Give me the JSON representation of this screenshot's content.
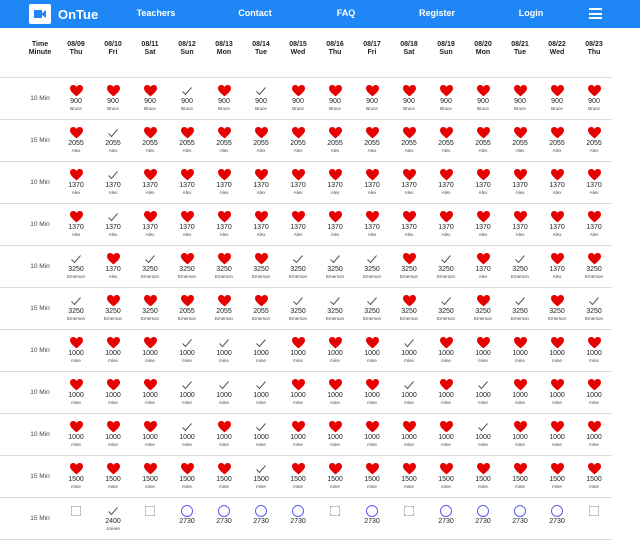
{
  "nav": {
    "brand": "OnTue",
    "links": [
      "Teachers",
      "Contact",
      "FAQ",
      "Register",
      "Login"
    ],
    "brand_color": "#1f86f5"
  },
  "header": {
    "time_label_1": "Time",
    "time_label_2": "Minute",
    "days": [
      {
        "date": "08/09",
        "dow": "Thu"
      },
      {
        "date": "08/10",
        "dow": "Fri"
      },
      {
        "date": "08/11",
        "dow": "Sat"
      },
      {
        "date": "08/12",
        "dow": "Sun"
      },
      {
        "date": "08/13",
        "dow": "Mon"
      },
      {
        "date": "08/14",
        "dow": "Tue"
      },
      {
        "date": "08/15",
        "dow": "Wed"
      },
      {
        "date": "08/16",
        "dow": "Thu"
      },
      {
        "date": "08/17",
        "dow": "Fri"
      },
      {
        "date": "08/18",
        "dow": "Sat"
      },
      {
        "date": "08/19",
        "dow": "Sun"
      },
      {
        "date": "08/20",
        "dow": "Mon"
      },
      {
        "date": "08/21",
        "dow": "Tue"
      },
      {
        "date": "08/22",
        "dow": "Wed"
      },
      {
        "date": "08/23",
        "dow": "Thu"
      }
    ]
  },
  "rows": [
    {
      "duration": "10 Min",
      "cells": [
        {
          "icon": "heart",
          "value": "900",
          "who": "Bruce"
        },
        {
          "icon": "heart",
          "value": "900",
          "who": "Bruce"
        },
        {
          "icon": "heart",
          "value": "900",
          "who": "Bruce"
        },
        {
          "icon": "check",
          "value": "900",
          "who": "Bruce"
        },
        {
          "icon": "heart",
          "value": "900",
          "who": "Bruce"
        },
        {
          "icon": "check",
          "value": "900",
          "who": "Bruce"
        },
        {
          "icon": "heart",
          "value": "900",
          "who": "Bruce"
        },
        {
          "icon": "heart",
          "value": "900",
          "who": "Bruce"
        },
        {
          "icon": "heart",
          "value": "900",
          "who": "Bruce"
        },
        {
          "icon": "heart",
          "value": "900",
          "who": "Bruce"
        },
        {
          "icon": "heart",
          "value": "900",
          "who": "Bruce"
        },
        {
          "icon": "heart",
          "value": "900",
          "who": "Bruce"
        },
        {
          "icon": "heart",
          "value": "900",
          "who": "Bruce"
        },
        {
          "icon": "heart",
          "value": "900",
          "who": "Bruce"
        },
        {
          "icon": "heart",
          "value": "900",
          "who": "Bruce"
        }
      ]
    },
    {
      "duration": "15 Min",
      "cells": [
        {
          "icon": "heart",
          "value": "2055",
          "who": "Alex"
        },
        {
          "icon": "check",
          "value": "2055",
          "who": "Alex"
        },
        {
          "icon": "heart",
          "value": "2055",
          "who": "Alex"
        },
        {
          "icon": "heart",
          "value": "2055",
          "who": "Alex"
        },
        {
          "icon": "heart",
          "value": "2055",
          "who": "Alex"
        },
        {
          "icon": "heart",
          "value": "2055",
          "who": "Alex"
        },
        {
          "icon": "heart",
          "value": "2055",
          "who": "Alex"
        },
        {
          "icon": "heart",
          "value": "2055",
          "who": "Alex"
        },
        {
          "icon": "heart",
          "value": "2055",
          "who": "Alex"
        },
        {
          "icon": "heart",
          "value": "2055",
          "who": "Alex"
        },
        {
          "icon": "heart",
          "value": "2055",
          "who": "Alex"
        },
        {
          "icon": "heart",
          "value": "2055",
          "who": "Alex"
        },
        {
          "icon": "heart",
          "value": "2055",
          "who": "Alex"
        },
        {
          "icon": "heart",
          "value": "2055",
          "who": "Alex"
        },
        {
          "icon": "heart",
          "value": "2055",
          "who": "Alex"
        }
      ]
    },
    {
      "duration": "10 Min",
      "cells": [
        {
          "icon": "heart",
          "value": "1370",
          "who": "Alex"
        },
        {
          "icon": "check",
          "value": "1370",
          "who": "Alex"
        },
        {
          "icon": "heart",
          "value": "1370",
          "who": "Alex"
        },
        {
          "icon": "heart",
          "value": "1370",
          "who": "Alex"
        },
        {
          "icon": "heart",
          "value": "1370",
          "who": "Alex"
        },
        {
          "icon": "heart",
          "value": "1370",
          "who": "Alex"
        },
        {
          "icon": "heart",
          "value": "1370",
          "who": "Alex"
        },
        {
          "icon": "heart",
          "value": "1370",
          "who": "Alex"
        },
        {
          "icon": "heart",
          "value": "1370",
          "who": "Alex"
        },
        {
          "icon": "heart",
          "value": "1370",
          "who": "Alex"
        },
        {
          "icon": "heart",
          "value": "1370",
          "who": "Alex"
        },
        {
          "icon": "heart",
          "value": "1370",
          "who": "Alex"
        },
        {
          "icon": "heart",
          "value": "1370",
          "who": "Alex"
        },
        {
          "icon": "heart",
          "value": "1370",
          "who": "Alex"
        },
        {
          "icon": "heart",
          "value": "1370",
          "who": "Alex"
        }
      ]
    },
    {
      "duration": "10 Min",
      "cells": [
        {
          "icon": "heart",
          "value": "1370",
          "who": "Alex"
        },
        {
          "icon": "check",
          "value": "1370",
          "who": "Alex"
        },
        {
          "icon": "heart",
          "value": "1370",
          "who": "Alex"
        },
        {
          "icon": "heart",
          "value": "1370",
          "who": "Alex"
        },
        {
          "icon": "heart",
          "value": "1370",
          "who": "Alex"
        },
        {
          "icon": "heart",
          "value": "1370",
          "who": "Alex"
        },
        {
          "icon": "heart",
          "value": "1370",
          "who": "Alex"
        },
        {
          "icon": "heart",
          "value": "1370",
          "who": "Alex"
        },
        {
          "icon": "heart",
          "value": "1370",
          "who": "Alex"
        },
        {
          "icon": "heart",
          "value": "1370",
          "who": "Alex"
        },
        {
          "icon": "heart",
          "value": "1370",
          "who": "Alex"
        },
        {
          "icon": "heart",
          "value": "1370",
          "who": "Alex"
        },
        {
          "icon": "heart",
          "value": "1370",
          "who": "Alex"
        },
        {
          "icon": "heart",
          "value": "1370",
          "who": "Alex"
        },
        {
          "icon": "heart",
          "value": "1370",
          "who": "Alex"
        }
      ]
    },
    {
      "duration": "10 Min",
      "cells": [
        {
          "icon": "check",
          "value": "3250",
          "who": "Emerson"
        },
        {
          "icon": "heart",
          "value": "1370",
          "who": "Alex"
        },
        {
          "icon": "check",
          "value": "3250",
          "who": "Emerson"
        },
        {
          "icon": "heart",
          "value": "3250",
          "who": "Emerson"
        },
        {
          "icon": "heart",
          "value": "3250",
          "who": "Emerson"
        },
        {
          "icon": "heart",
          "value": "3250",
          "who": "Emerson"
        },
        {
          "icon": "check",
          "value": "3250",
          "who": "Emerson"
        },
        {
          "icon": "check",
          "value": "3250",
          "who": "Emerson"
        },
        {
          "icon": "check",
          "value": "3250",
          "who": "Emerson"
        },
        {
          "icon": "heart",
          "value": "3250",
          "who": "Emerson"
        },
        {
          "icon": "check",
          "value": "3250",
          "who": "Emerson"
        },
        {
          "icon": "heart",
          "value": "1370",
          "who": "Alex"
        },
        {
          "icon": "check",
          "value": "3250",
          "who": "Emerson"
        },
        {
          "icon": "heart",
          "value": "1370",
          "who": "Alex"
        },
        {
          "icon": "heart",
          "value": "3250",
          "who": "Emerson"
        }
      ]
    },
    {
      "duration": "15 Min",
      "cells": [
        {
          "icon": "check",
          "value": "3250",
          "who": "Emerson"
        },
        {
          "icon": "heart",
          "value": "3250",
          "who": "Emerson"
        },
        {
          "icon": "heart",
          "value": "3250",
          "who": "Emerson"
        },
        {
          "icon": "heart",
          "value": "2055",
          "who": "Emerson"
        },
        {
          "icon": "heart",
          "value": "2055",
          "who": "Emerson"
        },
        {
          "icon": "heart",
          "value": "2055",
          "who": "Emerson"
        },
        {
          "icon": "check",
          "value": "3250",
          "who": "Emerson"
        },
        {
          "icon": "check",
          "value": "3250",
          "who": "Emerson"
        },
        {
          "icon": "check",
          "value": "3250",
          "who": "Emerson"
        },
        {
          "icon": "heart",
          "value": "3250",
          "who": "Emerson"
        },
        {
          "icon": "check",
          "value": "3250",
          "who": "Emerson"
        },
        {
          "icon": "heart",
          "value": "3250",
          "who": "Emerson"
        },
        {
          "icon": "check",
          "value": "3250",
          "who": "Emerson"
        },
        {
          "icon": "heart",
          "value": "3250",
          "who": "Emerson"
        },
        {
          "icon": "check",
          "value": "3250",
          "who": "Emerson"
        }
      ]
    },
    {
      "duration": "10 Min",
      "cells": [
        {
          "icon": "heart",
          "value": "1000",
          "who": "mine"
        },
        {
          "icon": "heart",
          "value": "1000",
          "who": "mine"
        },
        {
          "icon": "heart",
          "value": "1000",
          "who": "mine"
        },
        {
          "icon": "check",
          "value": "1000",
          "who": "mine"
        },
        {
          "icon": "check",
          "value": "1000",
          "who": "mine"
        },
        {
          "icon": "check",
          "value": "1000",
          "who": "mine"
        },
        {
          "icon": "heart",
          "value": "1000",
          "who": "mine"
        },
        {
          "icon": "heart",
          "value": "1000",
          "who": "mine"
        },
        {
          "icon": "heart",
          "value": "1000",
          "who": "mine"
        },
        {
          "icon": "check",
          "value": "1000",
          "who": "mine"
        },
        {
          "icon": "heart",
          "value": "1000",
          "who": "mine"
        },
        {
          "icon": "heart",
          "value": "1000",
          "who": "mine"
        },
        {
          "icon": "heart",
          "value": "1000",
          "who": "mine"
        },
        {
          "icon": "heart",
          "value": "1000",
          "who": "mine"
        },
        {
          "icon": "heart",
          "value": "1000",
          "who": "mine"
        }
      ]
    },
    {
      "duration": "10 Min",
      "cells": [
        {
          "icon": "heart",
          "value": "1000",
          "who": "mine"
        },
        {
          "icon": "heart",
          "value": "1000",
          "who": "mine"
        },
        {
          "icon": "heart",
          "value": "1000",
          "who": "mine"
        },
        {
          "icon": "check",
          "value": "1000",
          "who": "mine"
        },
        {
          "icon": "check",
          "value": "1000",
          "who": "mine"
        },
        {
          "icon": "check",
          "value": "1000",
          "who": "mine"
        },
        {
          "icon": "heart",
          "value": "1000",
          "who": "mine"
        },
        {
          "icon": "heart",
          "value": "1000",
          "who": "mine"
        },
        {
          "icon": "heart",
          "value": "1000",
          "who": "mine"
        },
        {
          "icon": "check",
          "value": "1000",
          "who": "mine"
        },
        {
          "icon": "heart",
          "value": "1000",
          "who": "mine"
        },
        {
          "icon": "check",
          "value": "1000",
          "who": "mine"
        },
        {
          "icon": "heart",
          "value": "1000",
          "who": "mine"
        },
        {
          "icon": "heart",
          "value": "1000",
          "who": "mine"
        },
        {
          "icon": "heart",
          "value": "1000",
          "who": "mine"
        }
      ]
    },
    {
      "duration": "10 Min",
      "cells": [
        {
          "icon": "heart",
          "value": "1000",
          "who": "mine"
        },
        {
          "icon": "heart",
          "value": "1000",
          "who": "mine"
        },
        {
          "icon": "heart",
          "value": "1000",
          "who": "mine"
        },
        {
          "icon": "check",
          "value": "1000",
          "who": "mine"
        },
        {
          "icon": "heart",
          "value": "1000",
          "who": "mine"
        },
        {
          "icon": "check",
          "value": "1000",
          "who": "mine"
        },
        {
          "icon": "heart",
          "value": "1000",
          "who": "mine"
        },
        {
          "icon": "heart",
          "value": "1000",
          "who": "mine"
        },
        {
          "icon": "heart",
          "value": "1000",
          "who": "mine"
        },
        {
          "icon": "heart",
          "value": "1000",
          "who": "mine"
        },
        {
          "icon": "heart",
          "value": "1000",
          "who": "mine"
        },
        {
          "icon": "check",
          "value": "1000",
          "who": "mine"
        },
        {
          "icon": "heart",
          "value": "1000",
          "who": "mine"
        },
        {
          "icon": "heart",
          "value": "1000",
          "who": "mine"
        },
        {
          "icon": "heart",
          "value": "1000",
          "who": "mine"
        }
      ]
    },
    {
      "duration": "15 Min",
      "cells": [
        {
          "icon": "heart",
          "value": "1500",
          "who": "mine"
        },
        {
          "icon": "heart",
          "value": "1500",
          "who": "mine"
        },
        {
          "icon": "heart",
          "value": "1500",
          "who": "mine"
        },
        {
          "icon": "heart",
          "value": "1500",
          "who": "mine"
        },
        {
          "icon": "heart",
          "value": "1500",
          "who": "mine"
        },
        {
          "icon": "check",
          "value": "1500",
          "who": "mine"
        },
        {
          "icon": "heart",
          "value": "1500",
          "who": "mine"
        },
        {
          "icon": "heart",
          "value": "1500",
          "who": "mine"
        },
        {
          "icon": "heart",
          "value": "1500",
          "who": "mine"
        },
        {
          "icon": "heart",
          "value": "1500",
          "who": "mine"
        },
        {
          "icon": "heart",
          "value": "1500",
          "who": "mine"
        },
        {
          "icon": "heart",
          "value": "1500",
          "who": "mine"
        },
        {
          "icon": "heart",
          "value": "1500",
          "who": "mine"
        },
        {
          "icon": "heart",
          "value": "1500",
          "who": "mine"
        },
        {
          "icon": "heart",
          "value": "1500",
          "who": "mine"
        }
      ]
    },
    {
      "duration": "15 Min",
      "cells": [
        {
          "icon": "empty",
          "value": "",
          "who": ""
        },
        {
          "icon": "check",
          "value": "2400",
          "who": "Joreen"
        },
        {
          "icon": "empty",
          "value": "",
          "who": ""
        },
        {
          "icon": "circle",
          "value": "2730",
          "who": ""
        },
        {
          "icon": "circle",
          "value": "2730",
          "who": ""
        },
        {
          "icon": "circle",
          "value": "2730",
          "who": ""
        },
        {
          "icon": "circle",
          "value": "2730",
          "who": ""
        },
        {
          "icon": "empty",
          "value": "",
          "who": ""
        },
        {
          "icon": "circle",
          "value": "2730",
          "who": ""
        },
        {
          "icon": "empty",
          "value": "",
          "who": ""
        },
        {
          "icon": "circle",
          "value": "2730",
          "who": ""
        },
        {
          "icon": "circle",
          "value": "2730",
          "who": ""
        },
        {
          "icon": "circle",
          "value": "2730",
          "who": ""
        },
        {
          "icon": "circle",
          "value": "2730",
          "who": ""
        },
        {
          "icon": "empty",
          "value": "",
          "who": ""
        }
      ]
    }
  ]
}
